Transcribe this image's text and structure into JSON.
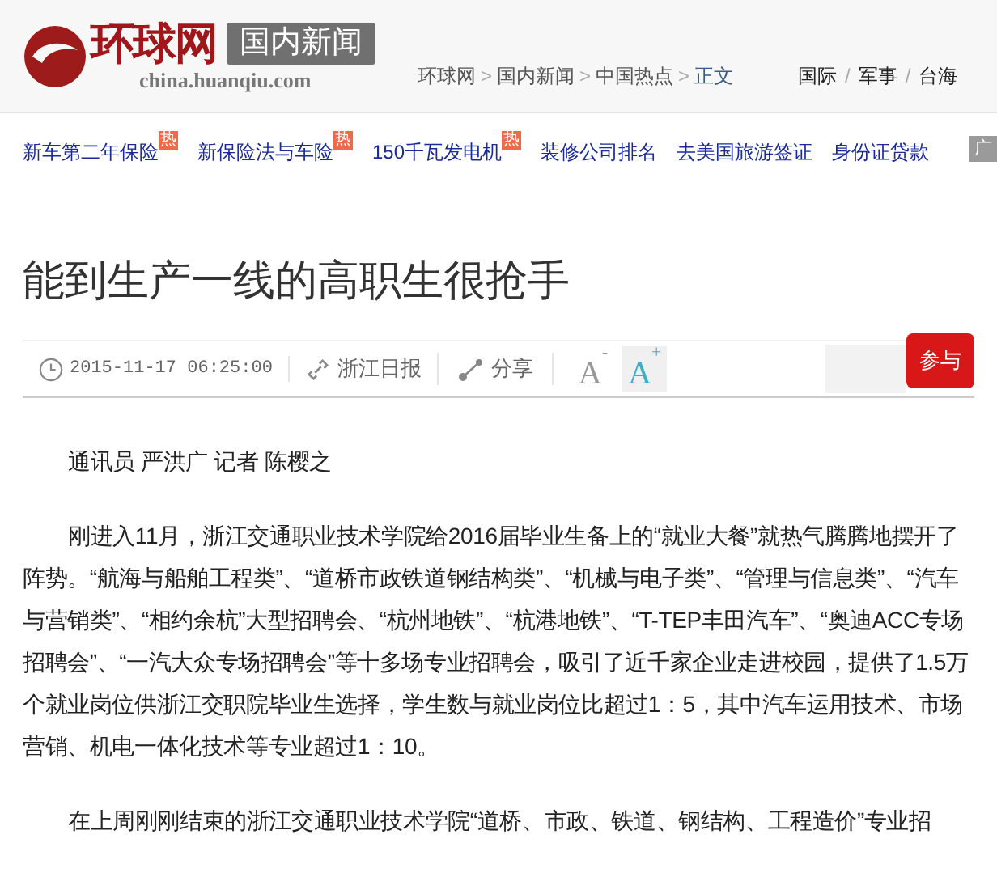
{
  "header": {
    "logo_text": "环球网",
    "channel_badge": "国内新闻",
    "site_url": "china.huanqiu.com",
    "breadcrumb": [
      "环球网",
      "国内新闻",
      "中国热点",
      "正文"
    ],
    "breadcrumb_sep": ">",
    "top_nav": [
      "国际",
      "军事",
      "台海"
    ],
    "top_nav_sep": "/"
  },
  "hot_links": [
    {
      "label": "新车第二年保险",
      "badge": "热"
    },
    {
      "label": "新保险法与车险",
      "badge": "热"
    },
    {
      "label": "150千瓦发电机",
      "badge": "热"
    },
    {
      "label": "装修公司排名"
    },
    {
      "label": "去美国旅游签证"
    },
    {
      "label": "身份证贷款"
    }
  ],
  "ad_badge": "广",
  "article": {
    "title": "能到生产一线的高职生很抢手",
    "meta": {
      "date": "2015-11-17 06:25:00",
      "source": "浙江日报",
      "share": "分享",
      "font_buttons": [
        {
          "letter": "A",
          "sign": "-",
          "selected": false
        },
        {
          "letter": "A",
          "sign": "+",
          "selected": true
        }
      ],
      "join": "参与"
    },
    "paragraphs": [
      "通讯员 严洪广 记者 陈樱之",
      "刚进入11月，浙江交通职业技术学院给2016届毕业生备上的“就业大餐”就热气腾腾地摆开了阵势。“航海与船舶工程类”、“道桥市政铁道钢结构类”、“机械与电子类”、“管理与信息类”、“汽车与营销类”、“相约余杭”大型招聘会、“杭州地铁”、“杭港地铁”、“T-TEP丰田汽车”、“奥迪ACC专场招聘会”、“一汽大众专场招聘会”等十多场专业招聘会，吸引了近千家企业走进校园，提供了1.5万个就业岗位供浙江交职院毕业生选择，学生数与就业岗位比超过1：5，其中汽车运用技术、市场营销、机电一体化技术等专业超过1：10。",
      "在上周刚刚结束的浙江交通职业技术学院“道桥、市政、铁道、钢结构、工程造价”专业招"
    ]
  }
}
